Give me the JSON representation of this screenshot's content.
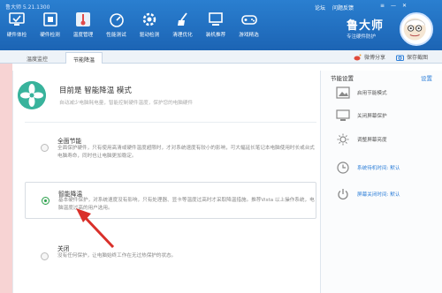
{
  "app": {
    "title": "鲁大师 5.21.1300",
    "links": [
      "论坛",
      "问题反馈"
    ],
    "window_controls": [
      "≡",
      "—",
      "✕"
    ],
    "brand_name": "鲁大师",
    "brand_slogan": "专注硬件防护"
  },
  "toolbar": {
    "items": [
      {
        "label": "硬件体检",
        "icon": "monitor-check-icon"
      },
      {
        "label": "硬件检测",
        "icon": "hardware-icon"
      },
      {
        "label": "温度管理",
        "icon": "thermometer-icon"
      },
      {
        "label": "性能测试",
        "icon": "speedometer-icon"
      },
      {
        "label": "驱动检测",
        "icon": "gear-icon"
      },
      {
        "label": "清理优化",
        "icon": "broom-icon"
      },
      {
        "label": "装机推荐",
        "icon": "computer-icon"
      },
      {
        "label": "游戏精选",
        "icon": "gamepad-icon"
      }
    ],
    "active_index": 2
  },
  "tabs": {
    "items": [
      "温度监控",
      "节能降温"
    ],
    "active_index": 1,
    "share_weibo": "微博分享",
    "save_screenshot": "保存截图"
  },
  "main": {
    "heading": "目前是 智能降温 模式",
    "description": "自动减少电脑耗电量，智能控制硬件温度，保护您的电脑硬件",
    "options": [
      {
        "title": "全面节能",
        "desc": "全面保护硬件，只有使用高清或硬件温度超限时，才对系统速度有较小的影响，可大幅延长笔记本电脑使用时长或台式电脑寿命，同时也让电脑更加稳定。",
        "selected": false
      },
      {
        "title": "智能降温",
        "desc": "基本硬件保护，对系统速度没有影响，只有处理器、显卡等温度过高时才采取降温措施。推荐Vista 以上操作系统，电脑温度过高的用户选用。",
        "selected": true
      },
      {
        "title": "关闭",
        "desc": "没有任何保护，让电脑始终工作在无过热保护的状态。",
        "selected": false
      }
    ]
  },
  "side": {
    "title": "节能设置",
    "settings_link": "设置",
    "items": [
      {
        "label": "启用节能模式",
        "icon": "image-icon",
        "active": false
      },
      {
        "label": "关闭屏幕保护",
        "icon": "monitor-icon",
        "active": false
      },
      {
        "label": "调整屏幕亮度",
        "icon": "sun-icon",
        "active": false
      },
      {
        "label": "系统待机时间: 默认",
        "icon": "clock-icon",
        "active": true
      },
      {
        "label": "屏幕关闭时间: 默认",
        "icon": "power-icon",
        "active": true
      }
    ]
  },
  "colors": {
    "topbar": "#1f6cc0",
    "accent_green": "#2aa34b",
    "link_blue": "#2e7fd8",
    "annotation_red": "#d9302a"
  }
}
